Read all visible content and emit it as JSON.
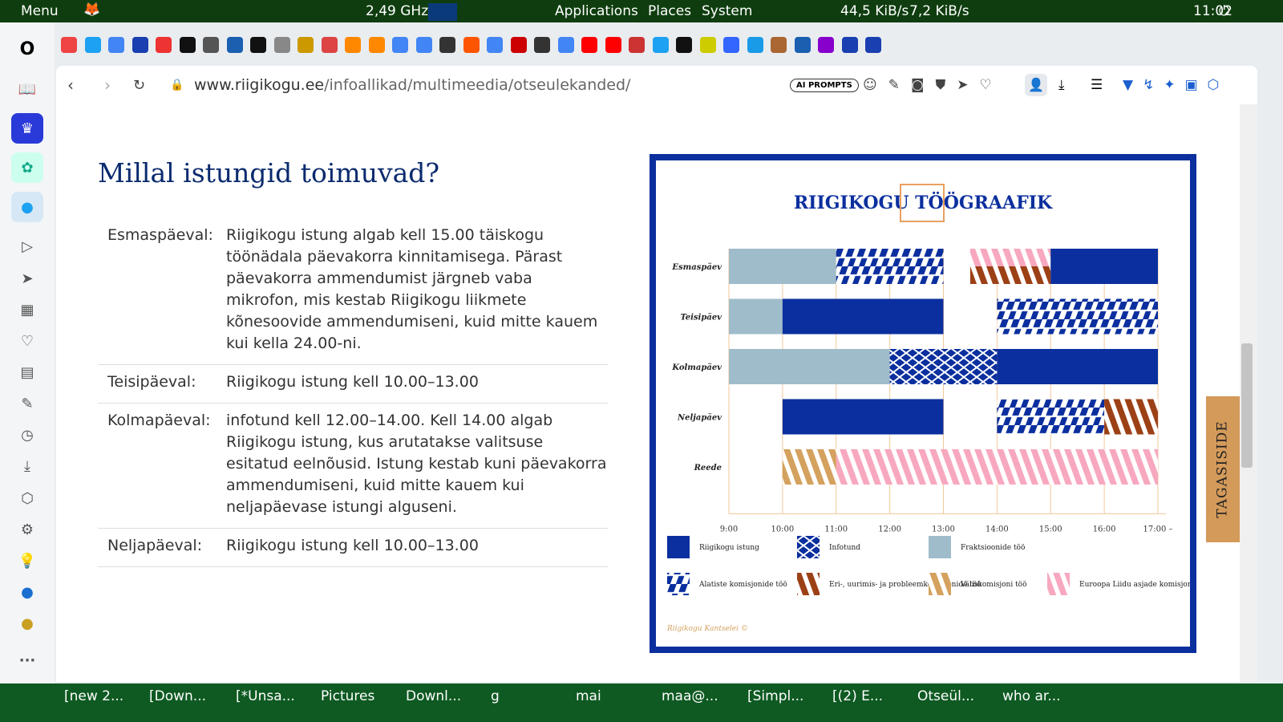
{
  "topbar": {
    "menu": "Menu",
    "cpu": "2,49 GHz",
    "applications": "Applications",
    "places": "Places",
    "system": "System",
    "net_down": "44,5 KiB/s",
    "net_up": "7,2 KiB/s",
    "clock": "11:02"
  },
  "browser": {
    "url_host": "www.riigikogu.ee",
    "url_path": "/infoallikad/multimeedia/otseulekanded/",
    "ai_prompts": "AI PROMPTS"
  },
  "page": {
    "title": "Millal istungid toimuvad?",
    "rows": [
      {
        "day": "Esmaspäeval:",
        "text": "Riigikogu istung algab kell 15.00 täiskogu töönädala päevakorra kinnitamisega. Pärast päevakorra ammendumist järgneb vaba mikrofon, mis kestab Riigikogu liikmete kõnesoovide ammendumiseni, kuid mitte kauem kui kella 24.00-ni."
      },
      {
        "day": "Teisipäeval:",
        "text": "Riigikogu istung kell 10.00–13.00"
      },
      {
        "day": "Kolmapäeval:",
        "text": "infotund kell 12.00–14.00. Kell 14.00 algab Riigikogu istung, kus arutatakse valitsuse esitatud eelnõusid. Istung kestab kuni päevakorra ammendumiseni, kuid mitte kauem kui neljapäevase istungi alguseni."
      },
      {
        "day": "Neljapäeval:",
        "text": "Riigikogu istung kell 10.00–13.00"
      }
    ],
    "feedback": "TAGASISIDE"
  },
  "chart_data": {
    "type": "gantt",
    "title": "RIIGIKOGU TÖÖGRAAFIK",
    "x_ticks": [
      "9:00",
      "10:00",
      "11:00",
      "12:00",
      "13:00",
      "14:00",
      "15:00",
      "16:00",
      "17:00 –"
    ],
    "xlim": [
      9,
      17
    ],
    "days": [
      "Esmaspäev",
      "Teisipäev",
      "Kolmapäev",
      "Neljapäev",
      "Reede"
    ],
    "legend": [
      {
        "key": "istung",
        "label": "Riigikogu istung",
        "color": "#0b2f9e"
      },
      {
        "key": "infotund",
        "label": "Infotund",
        "color": "#0b2f9e"
      },
      {
        "key": "fraktsioon",
        "label": "Fraktsioonide töö",
        "color": "#9fbccb"
      },
      {
        "key": "alatised",
        "label": "Alatiste komisjonide töö",
        "color": "#0b2f9e"
      },
      {
        "key": "eri",
        "label": "Eri-, uurimis- ja probleemkomisjonide töö",
        "color": "#9c4016"
      },
      {
        "key": "valis",
        "label": "Väliskomisjoni töö",
        "color": "#d4a15e"
      },
      {
        "key": "el",
        "label": "Euroopa Liidu asjade komisjoni töö",
        "color": "#f7a8bf"
      }
    ],
    "segments": [
      {
        "day": 0,
        "start": 9,
        "end": 11,
        "type": "fraktsioon"
      },
      {
        "day": 0,
        "start": 11,
        "end": 13,
        "type": "alatised"
      },
      {
        "day": 0,
        "start": 13.5,
        "end": 15,
        "type": "el",
        "half": "top"
      },
      {
        "day": 0,
        "start": 13.5,
        "end": 15,
        "type": "eri",
        "half": "bottom"
      },
      {
        "day": 0,
        "start": 15,
        "end": 17,
        "type": "istung"
      },
      {
        "day": 1,
        "start": 9,
        "end": 10,
        "type": "fraktsioon"
      },
      {
        "day": 1,
        "start": 10,
        "end": 13,
        "type": "istung"
      },
      {
        "day": 1,
        "start": 14,
        "end": 17,
        "type": "alatised"
      },
      {
        "day": 2,
        "start": 9,
        "end": 12,
        "type": "fraktsioon"
      },
      {
        "day": 2,
        "start": 12,
        "end": 14,
        "type": "infotund"
      },
      {
        "day": 2,
        "start": 14,
        "end": 17,
        "type": "istung"
      },
      {
        "day": 3,
        "start": 10,
        "end": 13,
        "type": "istung"
      },
      {
        "day": 3,
        "start": 14,
        "end": 16,
        "type": "alatised"
      },
      {
        "day": 3,
        "start": 16,
        "end": 17,
        "type": "eri"
      },
      {
        "day": 4,
        "start": 10,
        "end": 11,
        "type": "valis"
      },
      {
        "day": 4,
        "start": 11,
        "end": 17,
        "type": "el"
      }
    ],
    "credit": "Riigikogu Kantselei ©"
  },
  "taskbar": [
    "[new 2...",
    "[Down...",
    "[*Unsa...",
    "Pictures",
    "Downl...",
    "g",
    "mai",
    "maa@...",
    "[Simpl...",
    "[(2) E...",
    "Otseül...",
    "who ar..."
  ]
}
